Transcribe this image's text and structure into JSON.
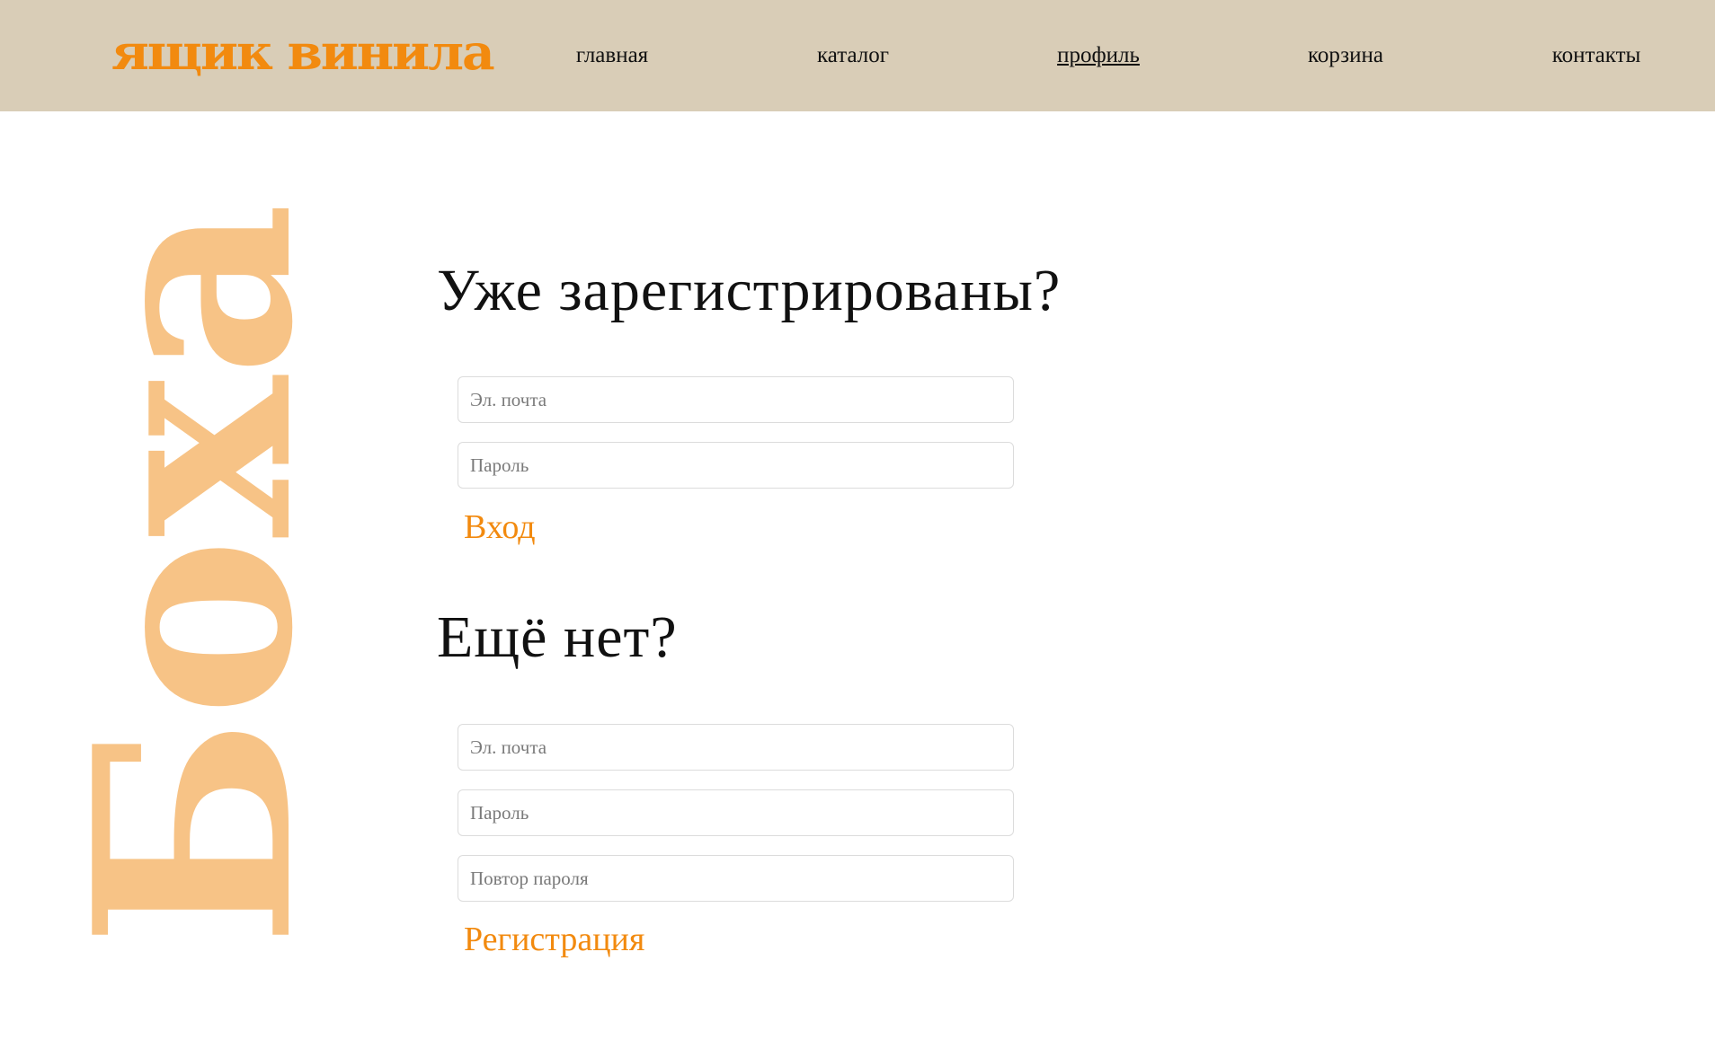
{
  "header": {
    "logo": "ящик винила",
    "nav": [
      {
        "label": "главная",
        "active": false
      },
      {
        "label": "каталог",
        "active": false
      },
      {
        "label": "профиль",
        "active": true
      },
      {
        "label": "корзина",
        "active": false
      },
      {
        "label": "контакты",
        "active": false
      }
    ]
  },
  "decorative_text": "Боха",
  "colors": {
    "accent": "#f28a0f",
    "header_bg": "#d9cdb7",
    "decor": "#f7c386"
  },
  "login": {
    "title": "Уже зарегистрированы?",
    "email_placeholder": "Эл. почта",
    "password_placeholder": "Пароль",
    "submit_label": "Вход"
  },
  "register": {
    "title": "Ещё нет?",
    "email_placeholder": "Эл. почта",
    "password_placeholder": "Пароль",
    "repeat_placeholder": "Повтор пароля",
    "submit_label": "Регистрация"
  }
}
